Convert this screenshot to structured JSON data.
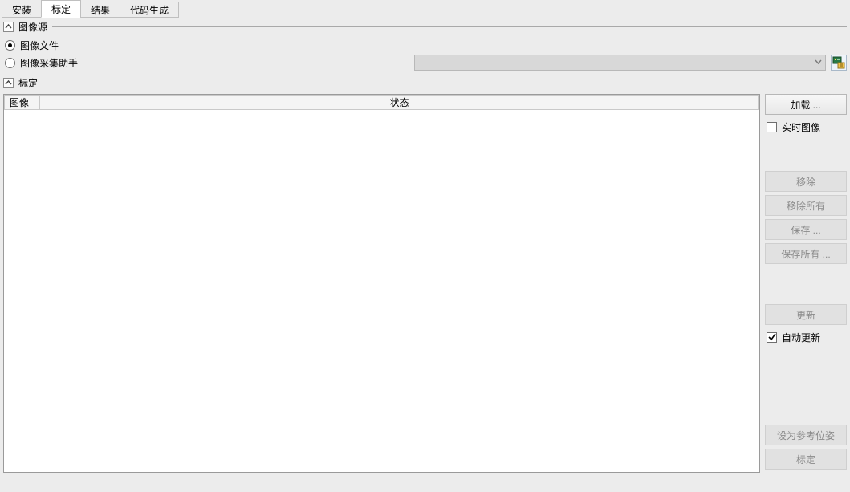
{
  "tabs": {
    "install": "安装",
    "calibrate": "标定",
    "result": "结果",
    "codegen": "代码生成"
  },
  "source": {
    "group_title": "图像源",
    "file_label": "图像文件",
    "assistant_label": "图像采集助手",
    "selected": "file",
    "combo_value": ""
  },
  "calib": {
    "group_title": "标定",
    "col_image": "图像",
    "col_status": "状态"
  },
  "buttons": {
    "load": "加载 ...",
    "live": "实时图像",
    "remove": "移除",
    "remove_all": "移除所有",
    "save": "保存 ...",
    "save_all": "保存所有 ...",
    "update": "更新",
    "auto_update": "自动更新",
    "set_ref": "设为参考位姿",
    "calibrate": "标定"
  },
  "state": {
    "live_checked": false,
    "auto_update_checked": true
  },
  "icons": {
    "collapse": "chevron-up-icon",
    "combo_arrow": "chevron-down-icon",
    "connect": "assistant-connect-icon"
  }
}
